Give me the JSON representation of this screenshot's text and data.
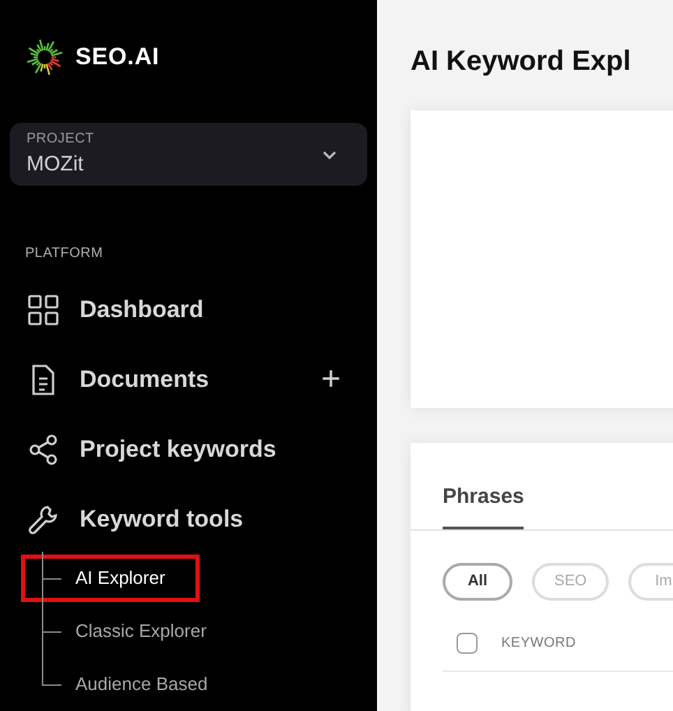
{
  "sidebar": {
    "logo_text": "SEO.AI",
    "project": {
      "label": "PROJECT",
      "value": "MOZit"
    },
    "section_label": "PLATFORM",
    "items": [
      {
        "kind": "grid",
        "label": "Dashboard"
      },
      {
        "kind": "document",
        "label": "Documents",
        "action": "+"
      },
      {
        "kind": "share",
        "label": "Project keywords"
      },
      {
        "kind": "wrench",
        "label": "Keyword tools",
        "expanded": true,
        "children": [
          {
            "label": "AI Explorer",
            "selected": true
          },
          {
            "label": "Classic Explorer",
            "selected": false
          },
          {
            "label": "Audience Based",
            "selected": false
          }
        ]
      }
    ]
  },
  "main": {
    "title": "AI Keyword Expl",
    "tabs": [
      {
        "label": "Phrases",
        "selected": true
      }
    ],
    "filters": [
      {
        "label": "All",
        "selected": true
      },
      {
        "label": "SEO",
        "selected": false
      },
      {
        "label": "Im",
        "selected": false
      }
    ],
    "table": {
      "select_all": {
        "checked": false
      },
      "columns": [
        "KEYWORD"
      ]
    }
  }
}
